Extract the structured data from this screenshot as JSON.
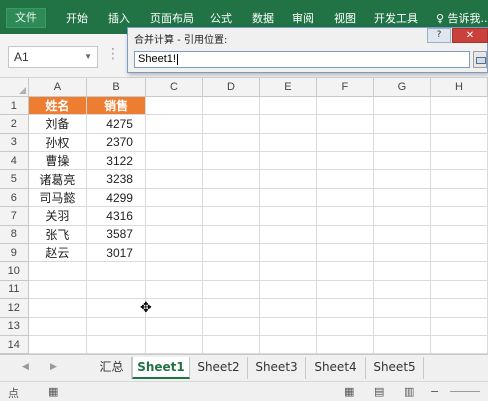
{
  "ribbon": {
    "file_tab": "文件",
    "tabs": [
      "开始",
      "插入",
      "页面布局",
      "公式",
      "数据",
      "审阅",
      "视图",
      "开发工具",
      "♀ 告诉我..."
    ]
  },
  "namebox": {
    "value": "A1"
  },
  "dialog": {
    "title": "合并计算 - 引用位置:",
    "help_label": "?",
    "close_label": "✕",
    "reference_value": "Sheet1!"
  },
  "grid": {
    "columns": [
      "A",
      "B",
      "C",
      "D",
      "E",
      "F",
      "G",
      "H"
    ],
    "rows": [
      {
        "num": "1",
        "a": "姓名",
        "b": "销售"
      },
      {
        "num": "2",
        "a": "刘备",
        "b": "4275"
      },
      {
        "num": "3",
        "a": "孙权",
        "b": "2370"
      },
      {
        "num": "4",
        "a": "曹操",
        "b": "3122"
      },
      {
        "num": "5",
        "a": "诸葛亮",
        "b": "3238"
      },
      {
        "num": "6",
        "a": "司马懿",
        "b": "4299"
      },
      {
        "num": "7",
        "a": "关羽",
        "b": "4316"
      },
      {
        "num": "8",
        "a": "张飞",
        "b": "3587"
      },
      {
        "num": "9",
        "a": "赵云",
        "b": "3017"
      },
      {
        "num": "10",
        "a": "",
        "b": ""
      },
      {
        "num": "11",
        "a": "",
        "b": ""
      },
      {
        "num": "12",
        "a": "",
        "b": ""
      },
      {
        "num": "13",
        "a": "",
        "b": ""
      },
      {
        "num": "14",
        "a": "",
        "b": ""
      },
      {
        "num": "15",
        "a": "",
        "b": ""
      }
    ],
    "header_color": "#ED7D31"
  },
  "sheet_tabs": {
    "items": [
      "汇总",
      "Sheet1",
      "Sheet2",
      "Sheet3",
      "Sheet4",
      "Sheet5"
    ],
    "active": "Sheet1"
  },
  "status": {
    "left_label": "点"
  },
  "theme": {
    "accent": "#217346"
  }
}
